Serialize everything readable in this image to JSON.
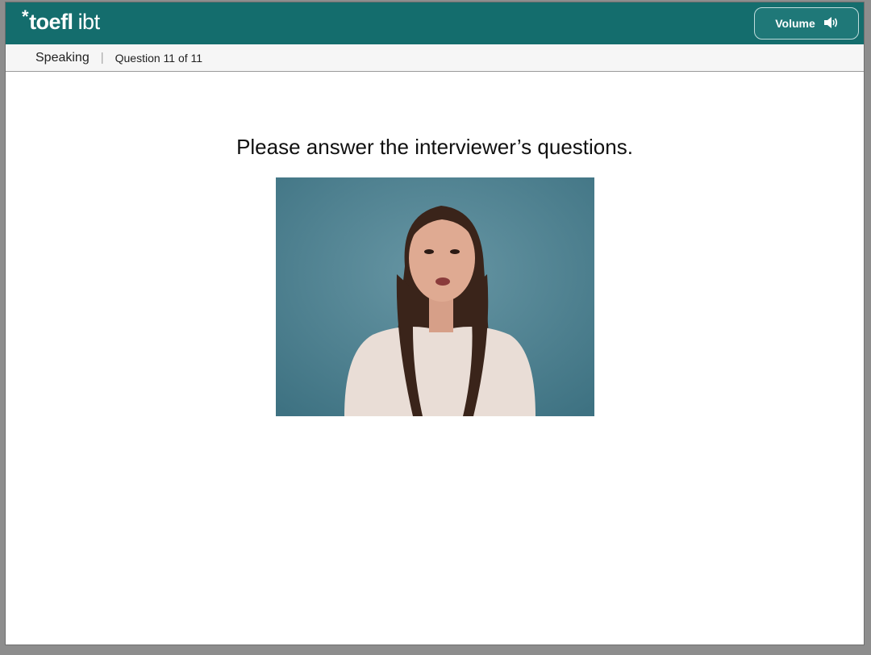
{
  "header": {
    "logo_star": "*",
    "logo_main": "toefl",
    "logo_suffix": "ibt",
    "volume_label": "Volume",
    "volume_icon": "speaker-icon"
  },
  "subheader": {
    "section": "Speaking",
    "separator": "|",
    "question_counter": "Question 11 of 11"
  },
  "main": {
    "prompt": "Please answer the interviewer’s questions."
  },
  "colors": {
    "header_bg": "#146d6d",
    "video_bg": "#4f8494"
  }
}
